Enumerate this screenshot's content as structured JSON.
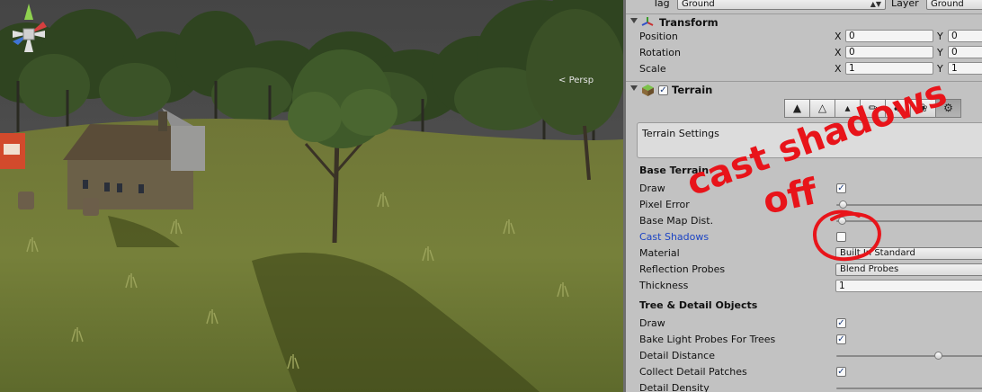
{
  "scene": {
    "persp_label": "Persp",
    "gizmo_axis_y": "y"
  },
  "inspector": {
    "tag_label": "Tag",
    "tag_value": "Ground",
    "layer_label": "Layer",
    "layer_value": "Ground",
    "transform": {
      "title": "Transform",
      "rows": [
        {
          "label": "Position",
          "x": "0",
          "y": "0"
        },
        {
          "label": "Rotation",
          "x": "0",
          "y": "0"
        },
        {
          "label": "Scale",
          "x": "1",
          "y": "1"
        }
      ],
      "axis_x": "X",
      "axis_y": "Y"
    },
    "terrain": {
      "title": "Terrain",
      "enabled": true,
      "toolbar_icons": [
        "raise-lower-icon",
        "paint-height-icon",
        "smooth-icon",
        "paint-texture-icon",
        "place-trees-icon",
        "paint-details-icon",
        "settings-gear-icon"
      ],
      "settings_box": "Terrain Settings",
      "base_terrain_header": "Base Terrain",
      "draw_label": "Draw",
      "draw_checked": true,
      "pixel_error_label": "Pixel Error",
      "pixel_error_level": 0.02,
      "base_map_dist_label": "Base Map Dist.",
      "base_map_dist_level": 0.02,
      "cast_shadows_label": "Cast Shadows",
      "cast_shadows_checked": false,
      "material_label": "Material",
      "material_value": "Built In Standard",
      "reflection_probes_label": "Reflection Probes",
      "reflection_probes_value": "Blend Probes",
      "thickness_label": "Thickness",
      "thickness_value": "1",
      "tree_detail_header": "Tree & Detail Objects",
      "tree_draw_label": "Draw",
      "tree_draw_checked": true,
      "bake_light_label": "Bake Light Probes For Trees",
      "bake_light_checked": true,
      "detail_distance_label": "Detail Distance",
      "detail_distance_level": 0.68,
      "collect_detail_label": "Collect Detail Patches",
      "collect_detail_checked": true,
      "detail_density_label": "Detail Density"
    }
  },
  "annotation": {
    "text_line1": "cast shadows",
    "text_line2": "off",
    "color": "#e8141a"
  },
  "colors": {
    "inspector_bg": "#c2c2c2",
    "highlight_label": "#1c44c4",
    "sky": "#4a4a4a",
    "grass": "#6d7a35"
  }
}
